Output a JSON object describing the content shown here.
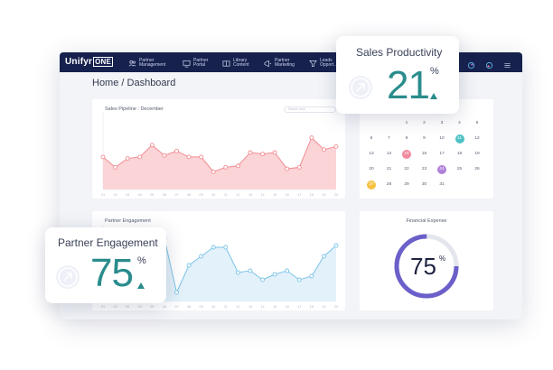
{
  "brand": {
    "logo_part1": "Unifyr",
    "logo_part2": "ONE"
  },
  "nav": {
    "items": [
      {
        "line1": "Partner",
        "line2": "Management"
      },
      {
        "line1": "Partner",
        "line2": "Portal"
      },
      {
        "line1": "Library",
        "line2": "Content"
      },
      {
        "line1": "Partner",
        "line2": "Marketing"
      },
      {
        "line1": "Leads",
        "line2": "Opport..."
      }
    ]
  },
  "breadcrumb": "Home / Dashboard",
  "sales_pipeline": {
    "title": "Sales Pipeline : December",
    "search_placeholder": "Search here",
    "x_labels": [
      "01",
      "02",
      "03",
      "04",
      "05",
      "06",
      "07",
      "08",
      "09",
      "10",
      "11",
      "12",
      "13",
      "14",
      "15",
      "16",
      "17",
      "18",
      "19",
      "20"
    ]
  },
  "partner_engagement_chart": {
    "title": "Partner Engagement",
    "x_labels": [
      "01",
      "02",
      "03",
      "04",
      "05",
      "06",
      "07",
      "08",
      "09",
      "10",
      "11",
      "12",
      "13",
      "14",
      "15",
      "16",
      "17",
      "18",
      "19",
      "20"
    ]
  },
  "calendar": {
    "rows": [
      [
        "",
        "",
        "1",
        "2",
        "3",
        "4",
        "5"
      ],
      [
        "6",
        "7",
        "8",
        "9",
        "10",
        "11",
        "12"
      ],
      [
        "13",
        "14",
        "15",
        "16",
        "17",
        "18",
        "19"
      ],
      [
        "20",
        "21",
        "22",
        "23",
        "24",
        "25",
        "26"
      ],
      [
        "27",
        "28",
        "29",
        "30",
        "31",
        "",
        ""
      ]
    ],
    "highlights": {
      "11": "#4fc1c4",
      "15": "#f08aa0",
      "24": "#b07fd9",
      "27": "#f5c242"
    }
  },
  "financial_expense": {
    "title": "Financial Expense",
    "value": "75",
    "unit": "%",
    "percent": 75,
    "ring_color": "#6b5fc9"
  },
  "sales_productivity": {
    "title": "Sales Productivity",
    "value": "21",
    "unit": "%"
  },
  "partner_engagement": {
    "title": "Partner Engagement",
    "value": "75",
    "unit": "%"
  },
  "chart_data": [
    {
      "type": "area",
      "title": "Sales Pipeline : December",
      "x": [
        "01",
        "02",
        "03",
        "04",
        "05",
        "06",
        "07",
        "08",
        "09",
        "10",
        "11",
        "12",
        "13",
        "14",
        "15",
        "16",
        "17",
        "18",
        "19",
        "20"
      ],
      "series": [
        {
          "values": [
            44,
            30,
            42,
            44,
            60,
            46,
            52,
            44,
            44,
            24,
            30,
            32,
            50,
            48,
            50,
            28,
            30,
            70,
            54,
            58
          ],
          "color": "#f28b93"
        }
      ],
      "ylim": [
        0,
        100
      ]
    },
    {
      "type": "area",
      "title": "Partner Engagement",
      "x": [
        "01",
        "02",
        "03",
        "04",
        "05",
        "06",
        "07",
        "08",
        "09",
        "10",
        "11",
        "12",
        "13",
        "14",
        "15",
        "16",
        "17",
        "18",
        "19",
        "20"
      ],
      "series": [
        {
          "values": [
            46,
            40,
            50,
            60,
            36,
            70,
            10,
            40,
            50,
            60,
            60,
            32,
            34,
            24,
            30,
            34,
            24,
            28,
            50,
            62
          ],
          "color": "#7cc4e8"
        }
      ],
      "ylim": [
        0,
        80
      ]
    }
  ],
  "colors": {
    "navbar": "#16214d",
    "accent_teal": "#2a8c8c",
    "pipeline": "#f28b93",
    "engagement": "#7cc4e8"
  },
  "icons": {
    "up_arrow": "arrow-up-right-icon"
  }
}
